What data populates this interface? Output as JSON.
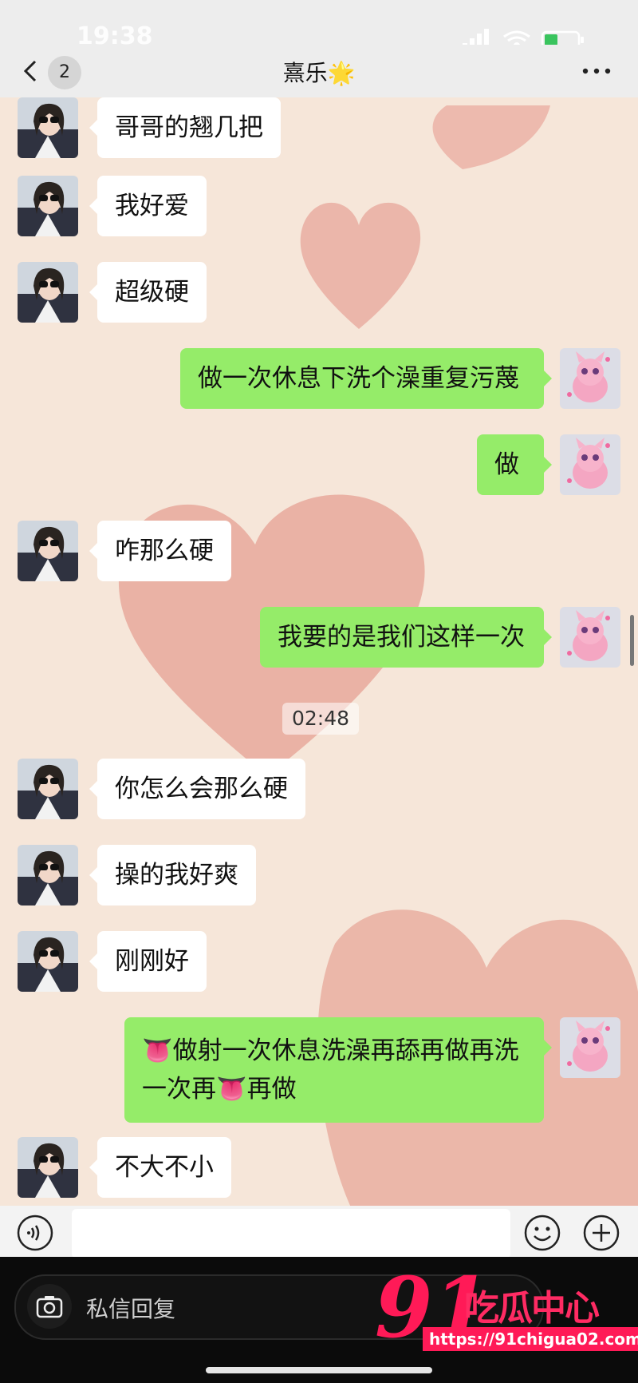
{
  "status_bar": {
    "time": "19:38"
  },
  "header": {
    "back_count": "2",
    "title": "熹乐🌟"
  },
  "messages": [
    {
      "side": "left",
      "text": "哥哥的翘几把"
    },
    {
      "side": "left",
      "text": "我好爱"
    },
    {
      "side": "left",
      "text": "超级硬"
    },
    {
      "side": "right",
      "text": "做一次休息下洗个澡重复污蔑"
    },
    {
      "side": "right",
      "text": "做"
    },
    {
      "side": "left",
      "text": "咋那么硬"
    },
    {
      "side": "right",
      "text": "我要的是我们这样一次"
    },
    {
      "type": "time",
      "text": "02:48"
    },
    {
      "side": "left",
      "text": "你怎么会那么硬"
    },
    {
      "side": "left",
      "text": "操的我好爽"
    },
    {
      "side": "left",
      "text": "刚刚好"
    },
    {
      "side": "right",
      "lines": [
        "👅做射一次休息洗澡再舔再做再洗",
        "一次再👅再做"
      ]
    },
    {
      "side": "left",
      "text": "不大不小"
    }
  ],
  "input_bar": {
    "placeholder": ""
  },
  "overlay": {
    "reply_placeholder": "私信回复",
    "logo_number": "91",
    "logo_text": "吃瓜中心",
    "logo_url": "https://91chigua02.com"
  },
  "colors": {
    "sent_bubble": "#95ec69",
    "received_bubble": "#ffffff",
    "logo_pink": "#ff1a57"
  },
  "icons": [
    "back-chevron-icon",
    "more-icon",
    "voice-icon",
    "emoji-icon",
    "plus-icon",
    "camera-icon",
    "signal-icon",
    "wifi-icon",
    "battery-icon"
  ]
}
